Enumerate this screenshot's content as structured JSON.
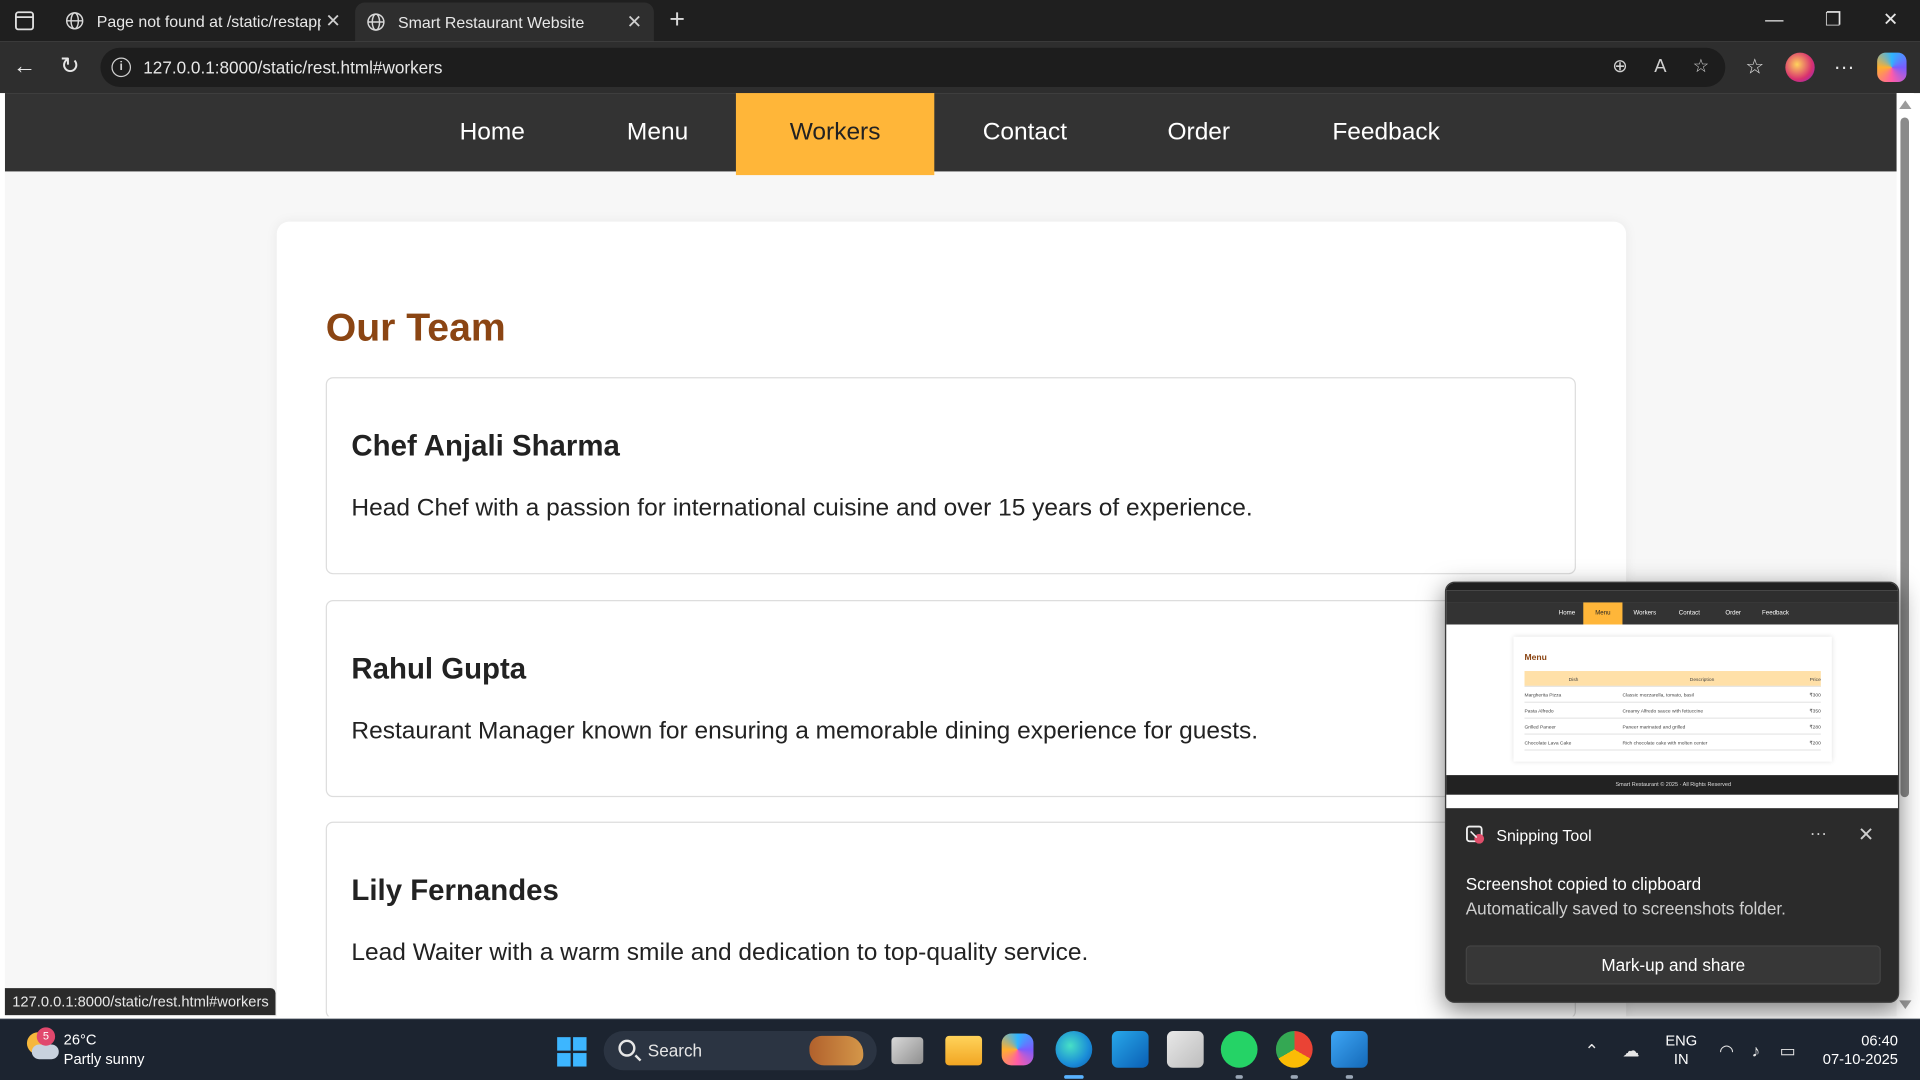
{
  "browser": {
    "tabs": [
      {
        "title": "Page not found at /static/restapp",
        "active": false
      },
      {
        "title": "Smart Restaurant Website",
        "active": true
      }
    ],
    "url": "127.0.0.1:8000/static/rest.html#workers",
    "status_url": "127.0.0.1:8000/static/rest.html#workers",
    "window_controls": {
      "minimize": "—",
      "restore": "❐",
      "close": "✕"
    }
  },
  "site": {
    "nav": [
      {
        "label": "Home"
      },
      {
        "label": "Menu"
      },
      {
        "label": "Workers",
        "active": true
      },
      {
        "label": "Contact"
      },
      {
        "label": "Order"
      },
      {
        "label": "Feedback"
      }
    ],
    "section_title": "Our Team",
    "workers": [
      {
        "name": "Chef Anjali Sharma",
        "description": "Head Chef with a passion for international cuisine and over 15 years of experience."
      },
      {
        "name": "Rahul Gupta",
        "description": "Restaurant Manager known for ensuring a memorable dining experience for guests."
      },
      {
        "name": "Lily Fernandes",
        "description": "Lead Waiter with a warm smile and dedication to top-quality service."
      }
    ],
    "colors": {
      "nav_bg": "#333333",
      "nav_active": "#ffb639",
      "heading": "#8b4513"
    }
  },
  "toast": {
    "app_name": "Snipping Tool",
    "title": "Screenshot copied to clipboard",
    "body": "Automatically saved to screenshots folder.",
    "button": "Mark-up and share",
    "more": "···",
    "close": "✕"
  },
  "taskbar": {
    "weather": {
      "temp": "26°C",
      "condition": "Partly sunny",
      "badge": "5"
    },
    "search_label": "Search",
    "language": {
      "line1": "ENG",
      "line2": "IN"
    },
    "clock": {
      "time": "06:40",
      "date": "07-10-2025"
    }
  }
}
